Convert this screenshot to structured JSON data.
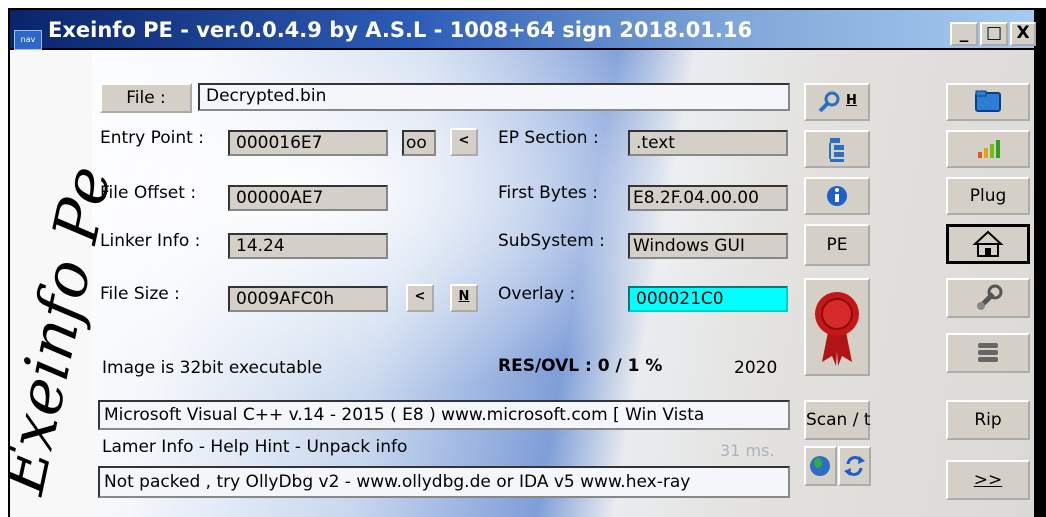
{
  "window": {
    "title": "Exeinfo PE - ver.0.0.4.9  by A.S.L -  1008+64 sign  2018.01.16",
    "icon_label": "nav",
    "controls": {
      "minimize": "_",
      "maximize": "□",
      "close": "X"
    }
  },
  "logo": {
    "text": "Exeinfo Pe"
  },
  "file": {
    "button_label": "File :",
    "name": "Decrypted.bin"
  },
  "entry_point": {
    "label": "Entry Point :",
    "value": "000016E7",
    "oo": "oo",
    "back": "<"
  },
  "ep_section": {
    "label": "EP Section :",
    "value": ".text"
  },
  "file_offset": {
    "label": "File Offset :",
    "value": "00000AE7"
  },
  "first_bytes": {
    "label": "First Bytes :",
    "value": "E8.2F.04.00.00"
  },
  "linker_info": {
    "label": "Linker Info :",
    "value": "14.24"
  },
  "subsystem": {
    "label": "SubSystem :",
    "value": "Windows GUI"
  },
  "file_size": {
    "label": "File Size :",
    "value": "0009AFC0h",
    "back": "<",
    "n": "N"
  },
  "overlay": {
    "label": "Overlay :",
    "value": "000021C0",
    "highlight_color": "#00ffff"
  },
  "image_info": "Image is 32bit executable",
  "res_ovl": {
    "label": "RES/OVL : 0 / 1 %",
    "year": "2020"
  },
  "detection": "Microsoft Visual C++ v.14 - 2015 ( E8 ) www.microsoft.com [ Win Vista",
  "lamer_info": {
    "text": "Lamer Info - Help Hint - Unpack info",
    "time": "31 ms."
  },
  "hint": "Not packed , try OllyDbg v2 - www.ollydbg.de or IDA v5 www.hex-ray",
  "middle_buttons": {
    "search_h": "H",
    "pe": "PE",
    "scan": "Scan / t"
  },
  "right_buttons": {
    "plug": "Plug",
    "rip": "Rip",
    "more": ">>"
  }
}
